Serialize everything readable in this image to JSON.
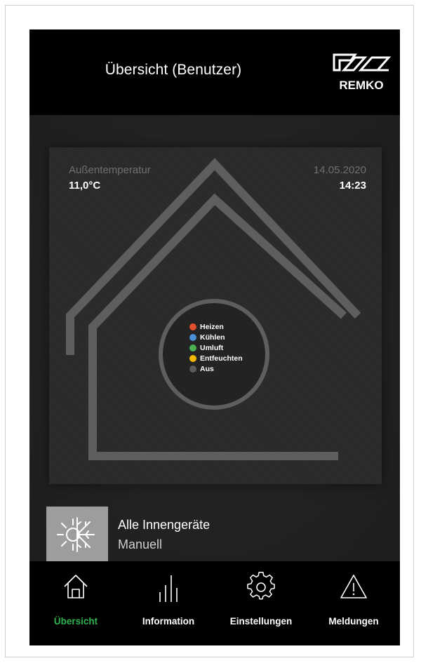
{
  "header": {
    "title": "Übersicht (Benutzer)",
    "logo_text": "REMKO"
  },
  "overview": {
    "outdoor_label": "Außentemperatur",
    "outdoor_value": "11,0°C",
    "date": "14.05.2020",
    "time": "14:23"
  },
  "legend": {
    "items": [
      {
        "label": "Heizen",
        "color": "#e0502d"
      },
      {
        "label": "Kühlen",
        "color": "#4a8fd8"
      },
      {
        "label": "Umluft",
        "color": "#4caf50"
      },
      {
        "label": "Entfeuchten",
        "color": "#f2b705"
      },
      {
        "label": "Aus",
        "color": "#5c5c5c"
      }
    ]
  },
  "device": {
    "name": "Alle Innengeräte",
    "mode": "Manuell",
    "icon": "sun-snowflake-icon"
  },
  "nav": {
    "active_color": "#2fb34f",
    "items": [
      {
        "label": "Übersicht",
        "icon": "home-icon",
        "active": true
      },
      {
        "label": "Information",
        "icon": "bars-icon",
        "active": false
      },
      {
        "label": "Einstellungen",
        "icon": "gear-icon",
        "active": false
      },
      {
        "label": "Meldungen",
        "icon": "warning-icon",
        "active": false
      }
    ]
  }
}
